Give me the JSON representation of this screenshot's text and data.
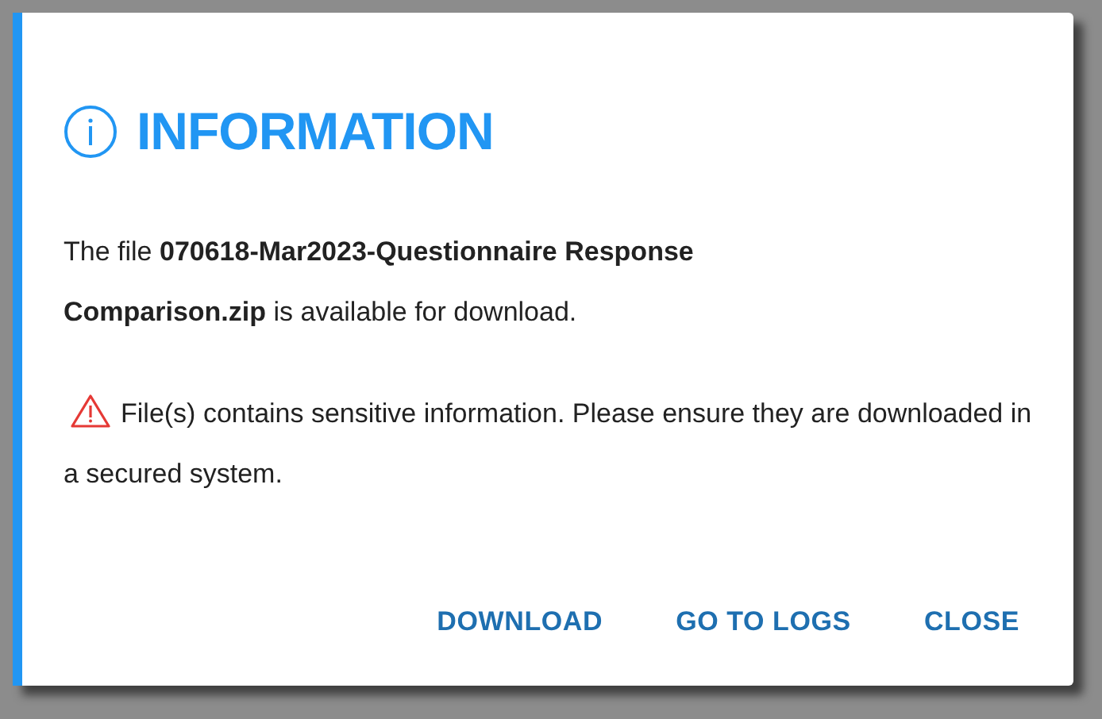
{
  "dialog": {
    "title": "INFORMATION",
    "message": "The file **070618-Mar2023-Questionnaire Response Comparison.zip** is available for download.",
    "warning": "File(s) contains sensitive information. Please ensure they are downloaded in a secured system.",
    "buttons": [
      "DOWNLOAD",
      "GO TO LOGS",
      "CLOSE"
    ]
  }
}
